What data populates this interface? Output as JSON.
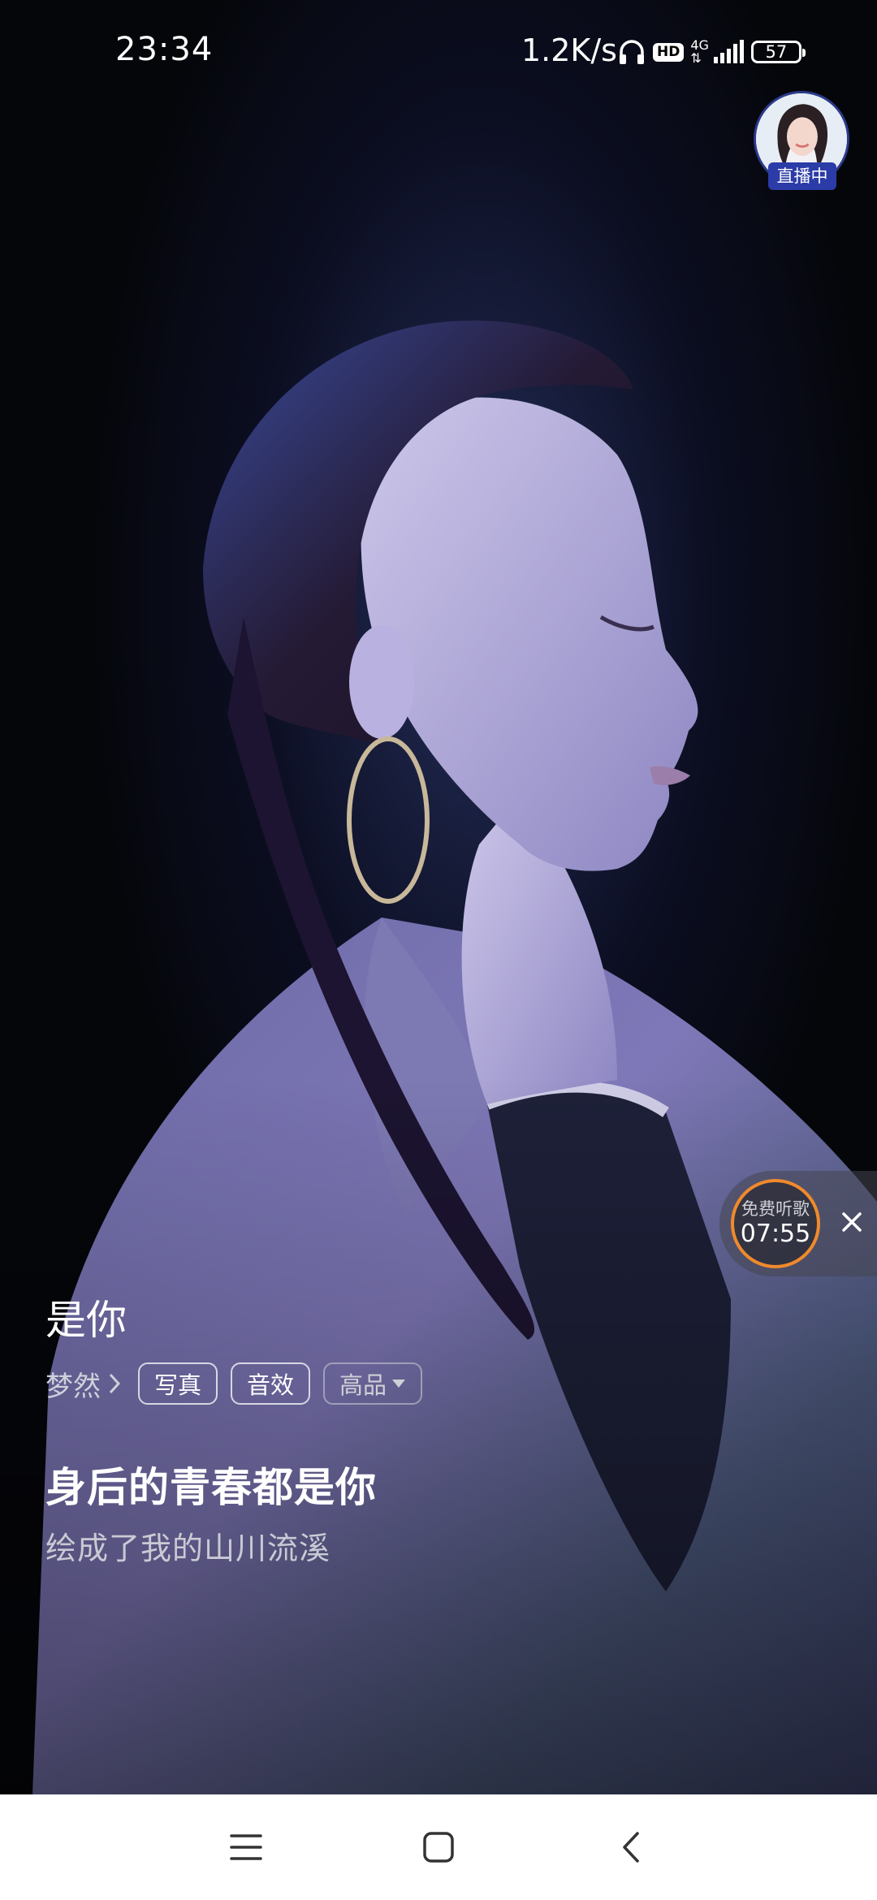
{
  "status_bar": {
    "time": "23:34",
    "network_speed": "1.2K/s",
    "hd_label": "HD",
    "network_type": "4G",
    "battery_level": "57"
  },
  "live": {
    "badge_label": "直播中"
  },
  "free_listen": {
    "label": "免费听歌",
    "remaining_time": "07:55",
    "accent_color": "#f08a2c"
  },
  "song": {
    "title": "是你",
    "artist": "梦然",
    "tags": {
      "photo": "写真",
      "effect": "音效",
      "quality": "高品"
    }
  },
  "lyrics": {
    "current_line": "身后的青春都是你",
    "next_line": "绘成了我的山川流溪"
  },
  "icons": {
    "headphones": "headphones-icon",
    "signal": "signal-icon",
    "close": "close-icon",
    "chevron": "chevron-right-icon",
    "caret": "caret-down-icon",
    "menu": "menu-icon",
    "home": "home-icon",
    "back": "back-icon"
  }
}
